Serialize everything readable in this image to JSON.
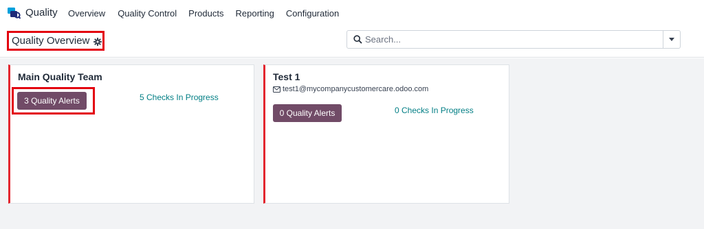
{
  "app": {
    "name": "Quality",
    "logo_icon": "quality-app-logo-icon",
    "brand_colors": [
      "#00a0dc",
      "#1e2a78"
    ]
  },
  "menu": {
    "items": [
      {
        "label": "Overview"
      },
      {
        "label": "Quality Control"
      },
      {
        "label": "Products"
      },
      {
        "label": "Reporting"
      },
      {
        "label": "Configuration"
      }
    ]
  },
  "control_panel": {
    "breadcrumb": "Quality Overview",
    "settings_icon": "gear-icon",
    "search": {
      "placeholder": "Search...",
      "value": "",
      "icon": "search-icon",
      "toggle_icon": "chevron-down-icon"
    }
  },
  "teams": [
    {
      "name": "Main Quality Team",
      "email": "",
      "alerts_label": "3 Quality Alerts",
      "checks_label": "5 Checks In Progress"
    },
    {
      "name": "Test 1",
      "email": "test1@mycompanycustomercare.odoo.com",
      "email_icon": "envelope-icon",
      "alerts_label": "0 Quality Alerts",
      "checks_label": "0 Checks In Progress"
    }
  ],
  "colors": {
    "primary": "#714b67",
    "link": "#017e84",
    "card_accent": "#e3262f",
    "highlight_box": "#e3000f"
  }
}
